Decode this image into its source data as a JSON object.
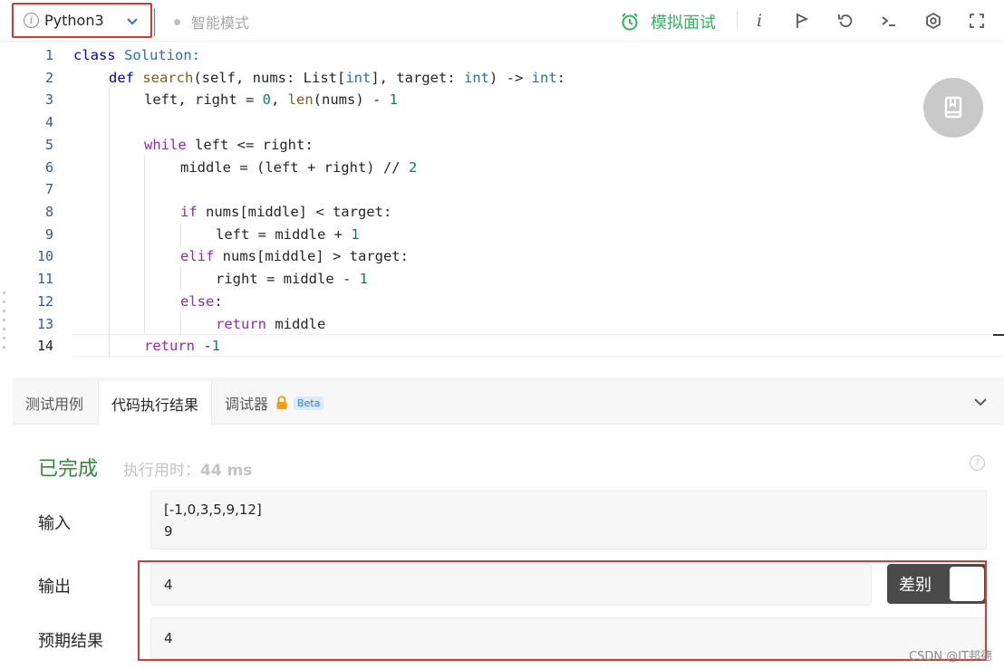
{
  "toolbar": {
    "language": "Python3",
    "mode_label": "智能模式",
    "mock_interview": "模拟面试"
  },
  "editor": {
    "lines": [
      {
        "n": "1"
      },
      {
        "n": "2"
      },
      {
        "n": "3"
      },
      {
        "n": "4"
      },
      {
        "n": "5"
      },
      {
        "n": "6"
      },
      {
        "n": "7"
      },
      {
        "n": "8"
      },
      {
        "n": "9"
      },
      {
        "n": "10"
      },
      {
        "n": "11"
      },
      {
        "n": "12"
      },
      {
        "n": "13"
      },
      {
        "n": "14"
      }
    ],
    "code": {
      "l1_kw": "class",
      "l1_name": "Solution:",
      "l2_kw": "def",
      "l2_fn": "search",
      "l2_a": "(self, nums: List[",
      "l2_t1": "int",
      "l2_b": "], target: ",
      "l2_t2": "int",
      "l2_c": ") -> ",
      "l2_t3": "int",
      "l2_d": ":",
      "l3_a": "left, right = ",
      "l3_n0": "0",
      "l3_b": ", ",
      "l3_fn": "len",
      "l3_c": "(nums) - ",
      "l3_n1": "1",
      "l5_kw": "while",
      "l5_a": " left <= right:",
      "l6_a": "middle = (left + right) // ",
      "l6_n": "2",
      "l8_kw": "if",
      "l8_a": " nums[middle] < target:",
      "l9_a": "left = middle + ",
      "l9_n": "1",
      "l10_kw": "elif",
      "l10_a": " nums[middle] > target:",
      "l11_a": "right = middle - ",
      "l11_n": "1",
      "l12_kw": "else",
      "l12_a": ":",
      "l13_kw": "return",
      "l13_a": " middle",
      "l14_kw": "return",
      "l14_a": " -",
      "l14_n": "1"
    }
  },
  "tabs": {
    "test_cases": "测试用例",
    "run_result": "代码执行结果",
    "debugger": "调试器",
    "beta": "Beta"
  },
  "result": {
    "status": "已完成",
    "time_label": "执行用时：",
    "time_value": "44 ms",
    "input_label": "输入",
    "input_line1": "[-1,0,3,5,9,12]",
    "input_line2": "9",
    "output_label": "输出",
    "output_value": "4",
    "expected_label": "预期结果",
    "expected_value": "4",
    "diff_label": "差别"
  },
  "watermark": "CSDN @IT邦德"
}
